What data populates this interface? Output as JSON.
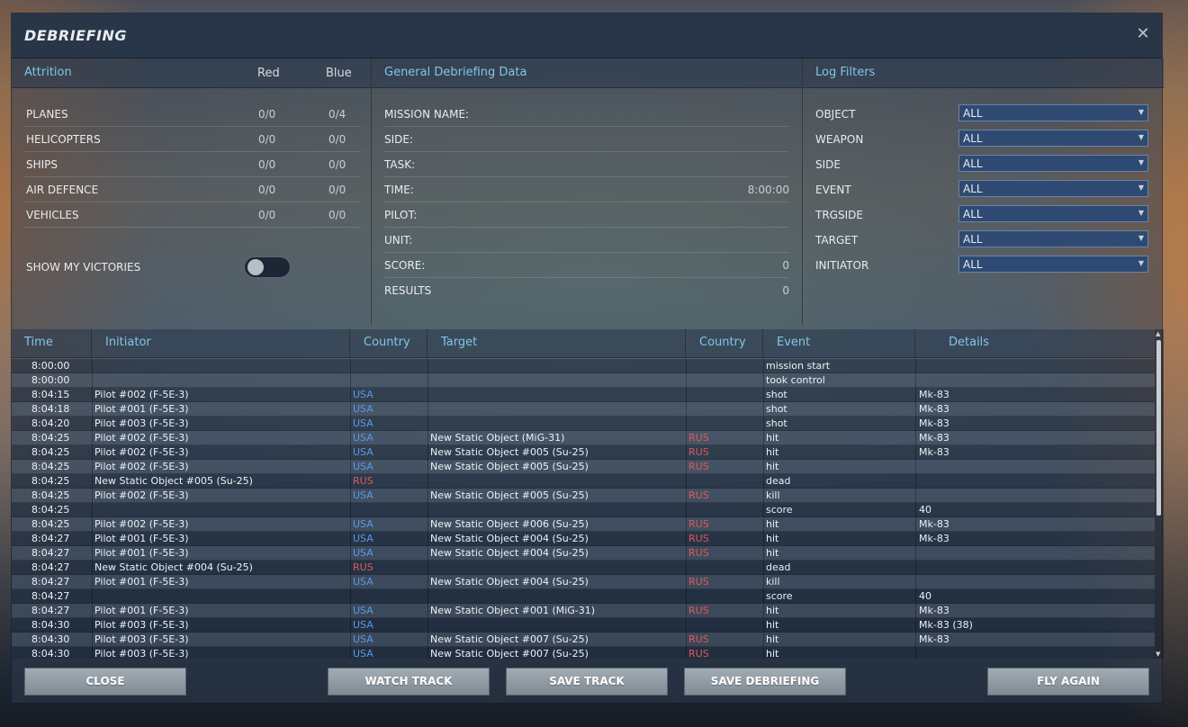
{
  "window": {
    "title": "DEBRIEFING",
    "close_icon": "close-icon"
  },
  "attrition": {
    "heading": "Attrition",
    "col_red": "Red",
    "col_blue": "Blue",
    "rows": [
      {
        "label": "PLANES",
        "red": "0/0",
        "blue": "0/4"
      },
      {
        "label": "HELICOPTERS",
        "red": "0/0",
        "blue": "0/0"
      },
      {
        "label": "SHIPS",
        "red": "0/0",
        "blue": "0/0"
      },
      {
        "label": "AIR DEFENCE",
        "red": "0/0",
        "blue": "0/0"
      },
      {
        "label": "VEHICLES",
        "red": "0/0",
        "blue": "0/0"
      }
    ],
    "show_victories_label": "SHOW MY VICTORIES",
    "show_victories_on": false
  },
  "general": {
    "heading": "General Debriefing Data",
    "rows": [
      {
        "label": "MISSION NAME:",
        "value": ""
      },
      {
        "label": "SIDE:",
        "value": ""
      },
      {
        "label": "TASK:",
        "value": ""
      },
      {
        "label": "TIME:",
        "value": "8:00:00"
      },
      {
        "label": "PILOT:",
        "value": ""
      },
      {
        "label": "UNIT:",
        "value": ""
      },
      {
        "label": "SCORE:",
        "value": "0"
      },
      {
        "label": "RESULTS",
        "value": "0"
      }
    ]
  },
  "filters": {
    "heading": "Log Filters",
    "rows": [
      {
        "label": "OBJECT",
        "value": "ALL"
      },
      {
        "label": "WEAPON",
        "value": "ALL"
      },
      {
        "label": "SIDE",
        "value": "ALL"
      },
      {
        "label": "EVENT",
        "value": "ALL"
      },
      {
        "label": "TRGSIDE",
        "value": "ALL"
      },
      {
        "label": "TARGET",
        "value": "ALL"
      },
      {
        "label": "INITIATOR",
        "value": "ALL"
      }
    ]
  },
  "log": {
    "columns": [
      "Time",
      "Initiator",
      "Country",
      "Target",
      "Country",
      "Event",
      "Details"
    ],
    "rows": [
      [
        "8:00:00",
        "",
        "",
        "",
        "",
        "mission start",
        ""
      ],
      [
        "8:00:00",
        "",
        "",
        "",
        "",
        "took control",
        ""
      ],
      [
        "8:04:15",
        "Pilot #002 (F-5E-3)",
        "USA",
        "",
        "",
        "shot",
        "Mk-83"
      ],
      [
        "8:04:18",
        "Pilot #001 (F-5E-3)",
        "USA",
        "",
        "",
        "shot",
        "Mk-83"
      ],
      [
        "8:04:20",
        "Pilot #003 (F-5E-3)",
        "USA",
        "",
        "",
        "shot",
        "Mk-83"
      ],
      [
        "8:04:25",
        "Pilot #002 (F-5E-3)",
        "USA",
        "New Static Object (MiG-31)",
        "RUS",
        "hit",
        "Mk-83"
      ],
      [
        "8:04:25",
        "Pilot #002 (F-5E-3)",
        "USA",
        "New Static Object #005 (Su-25)",
        "RUS",
        "hit",
        "Mk-83"
      ],
      [
        "8:04:25",
        "Pilot #002 (F-5E-3)",
        "USA",
        "New Static Object #005 (Su-25)",
        "RUS",
        "hit",
        ""
      ],
      [
        "8:04:25",
        "New Static Object #005 (Su-25)",
        "RUS",
        "",
        "",
        "dead",
        ""
      ],
      [
        "8:04:25",
        "Pilot #002 (F-5E-3)",
        "USA",
        "New Static Object #005 (Su-25)",
        "RUS",
        "kill",
        ""
      ],
      [
        "8:04:25",
        "",
        "",
        "",
        "",
        "score",
        "40"
      ],
      [
        "8:04:25",
        "Pilot #002 (F-5E-3)",
        "USA",
        "New Static Object #006 (Su-25)",
        "RUS",
        "hit",
        "Mk-83"
      ],
      [
        "8:04:27",
        "Pilot #001 (F-5E-3)",
        "USA",
        "New Static Object #004 (Su-25)",
        "RUS",
        "hit",
        "Mk-83"
      ],
      [
        "8:04:27",
        "Pilot #001 (F-5E-3)",
        "USA",
        "New Static Object #004 (Su-25)",
        "RUS",
        "hit",
        ""
      ],
      [
        "8:04:27",
        "New Static Object #004 (Su-25)",
        "RUS",
        "",
        "",
        "dead",
        ""
      ],
      [
        "8:04:27",
        "Pilot #001 (F-5E-3)",
        "USA",
        "New Static Object #004 (Su-25)",
        "RUS",
        "kill",
        ""
      ],
      [
        "8:04:27",
        "",
        "",
        "",
        "",
        "score",
        "40"
      ],
      [
        "8:04:27",
        "Pilot #001 (F-5E-3)",
        "USA",
        "New Static Object #001 (MiG-31)",
        "RUS",
        "hit",
        "Mk-83"
      ],
      [
        "8:04:30",
        "Pilot #003 (F-5E-3)",
        "USA",
        "",
        "",
        "hit",
        "Mk-83 (38)"
      ],
      [
        "8:04:30",
        "Pilot #003 (F-5E-3)",
        "USA",
        "New Static Object #007 (Su-25)",
        "RUS",
        "hit",
        "Mk-83"
      ],
      [
        "8:04:30",
        "Pilot #003 (F-5E-3)",
        "USA",
        "New Static Object #007 (Su-25)",
        "RUS",
        "hit",
        ""
      ]
    ]
  },
  "buttons": {
    "close": "CLOSE",
    "watch_track": "WATCH TRACK",
    "save_track": "SAVE TRACK",
    "save_debriefing": "SAVE DEBRIEFING",
    "fly_again": "FLY AGAIN"
  },
  "colors": {
    "blue_side": "#5a9ae8",
    "red_side": "#e2585a",
    "accent": "#7fc6e6"
  }
}
